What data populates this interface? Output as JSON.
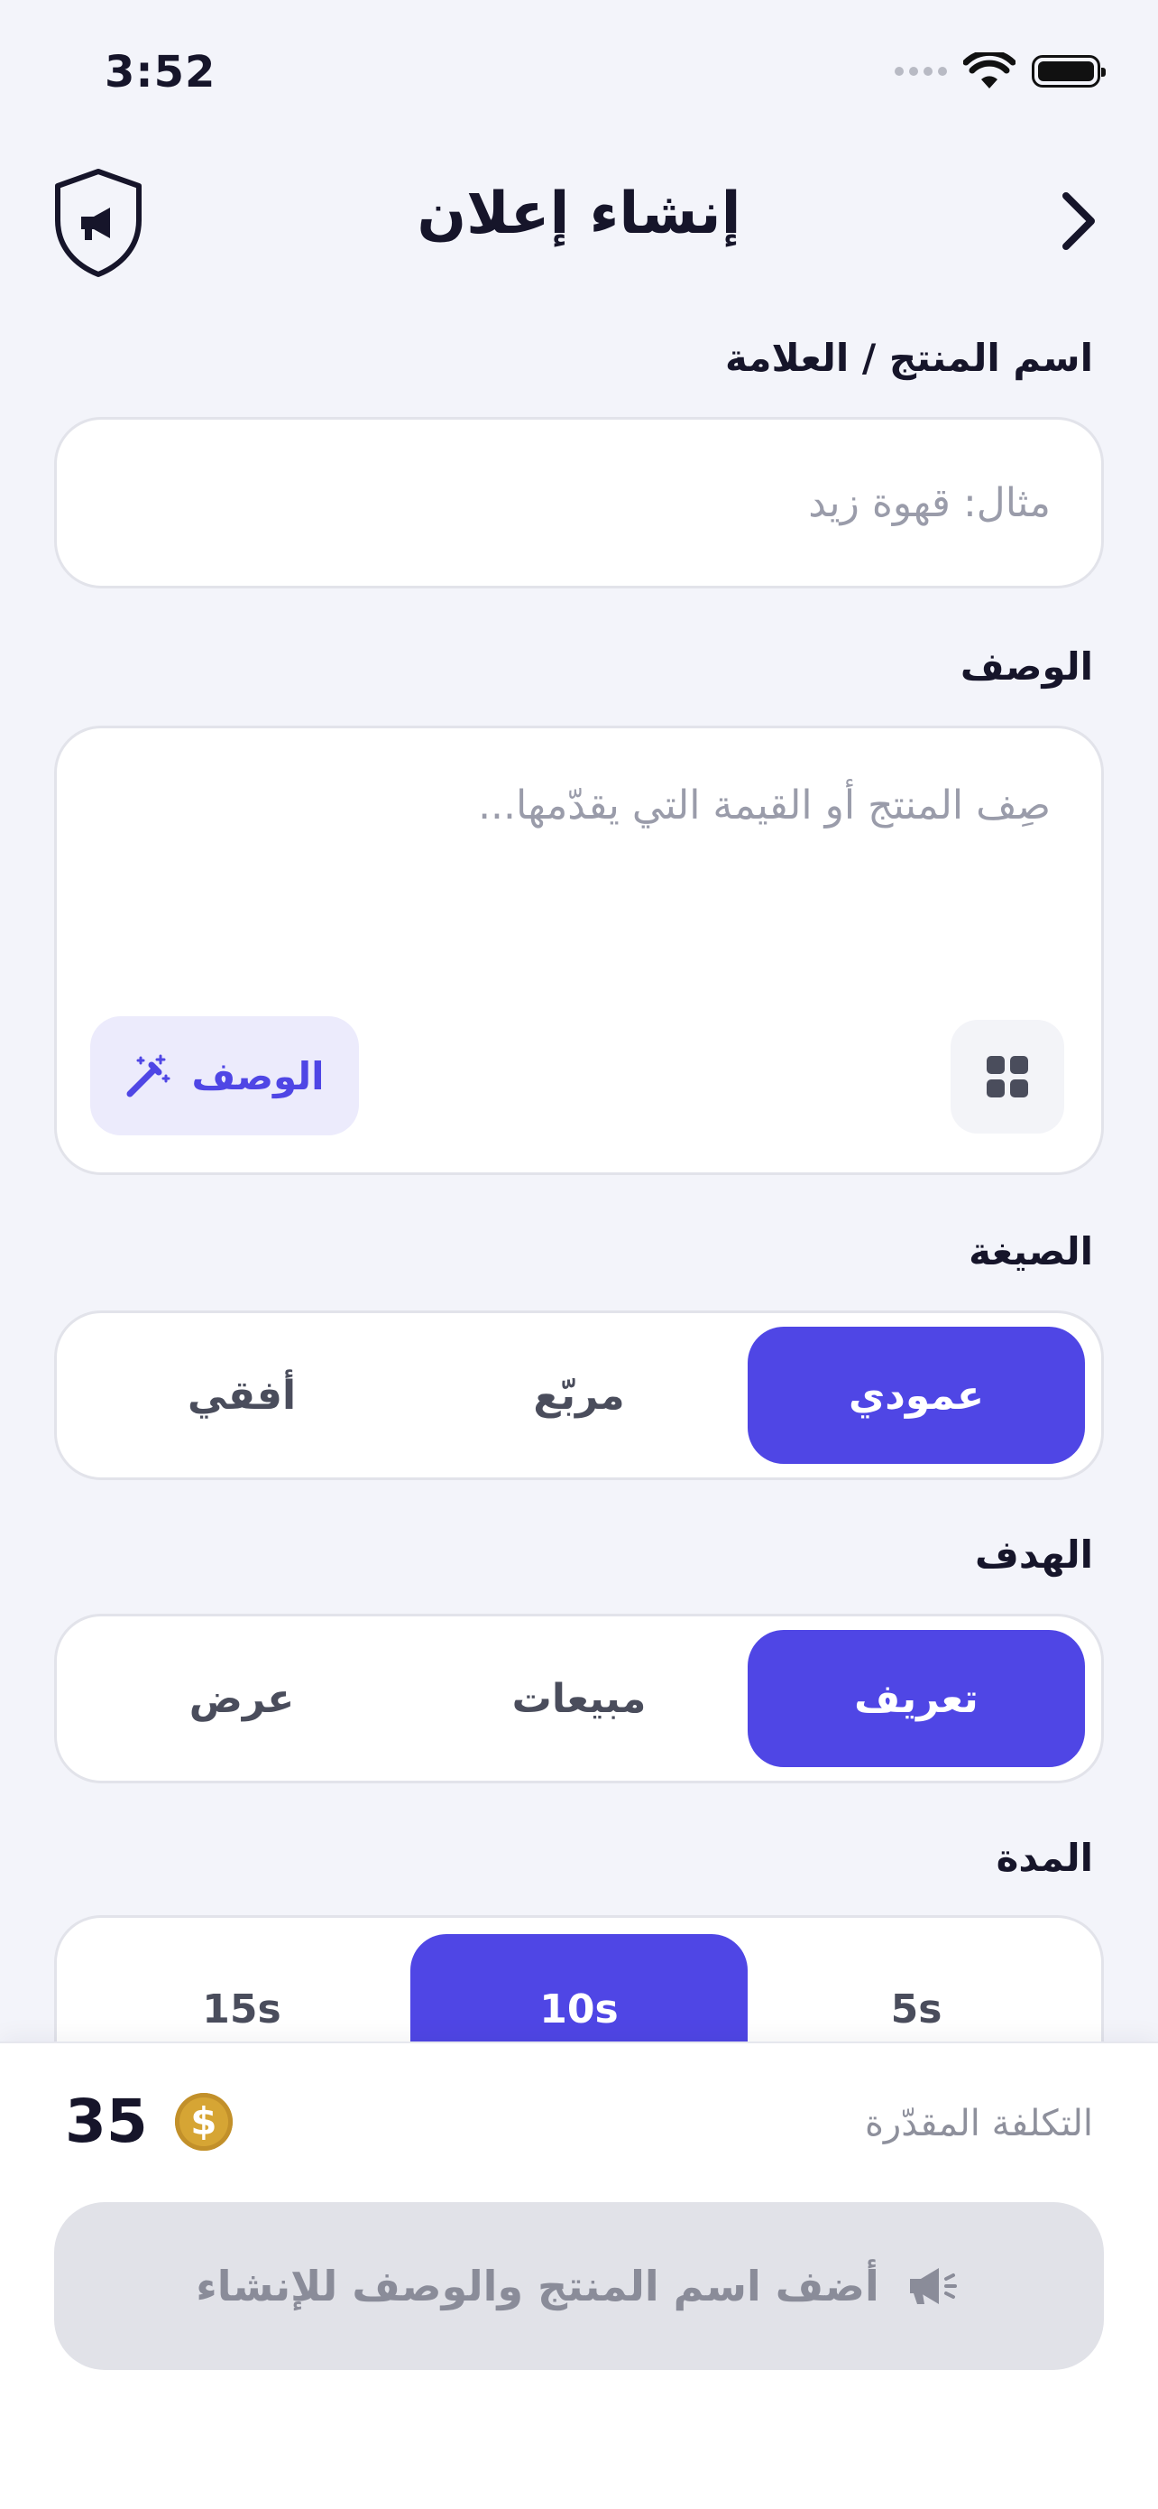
{
  "status_bar": {
    "time": "3:52"
  },
  "header": {
    "title": "إنشاء إعلان"
  },
  "product": {
    "label": "اسم المنتج / العلامة",
    "placeholder": "مثال: قهوة زيد",
    "value": ""
  },
  "description": {
    "label": "الوصف",
    "placeholder": "صِف المنتج أو القيمة التي يقدّمها...",
    "value": "",
    "magic_button_label": "الوصف"
  },
  "format": {
    "label": "الصيغة",
    "options": [
      "عمودي",
      "مربّع",
      "أفقي"
    ],
    "selected": "عمودي"
  },
  "goal": {
    "label": "الهدف",
    "options": [
      "تعريف",
      "مبيعات",
      "عرض"
    ],
    "selected": "تعريف"
  },
  "duration": {
    "label": "المدة",
    "options": [
      "15s",
      "10s",
      "5s"
    ],
    "selected": "10s"
  },
  "cost": {
    "label": "التكلفة المقدّرة",
    "value": "35",
    "currency_symbol": "$"
  },
  "create_button": {
    "label": "أضف اسم المنتج والوصف للإنشاء"
  },
  "colors": {
    "accent": "#4F46E5",
    "background": "#F3F4FA",
    "coin": "#D6A534",
    "disabled_button": "#E1E2E8"
  }
}
